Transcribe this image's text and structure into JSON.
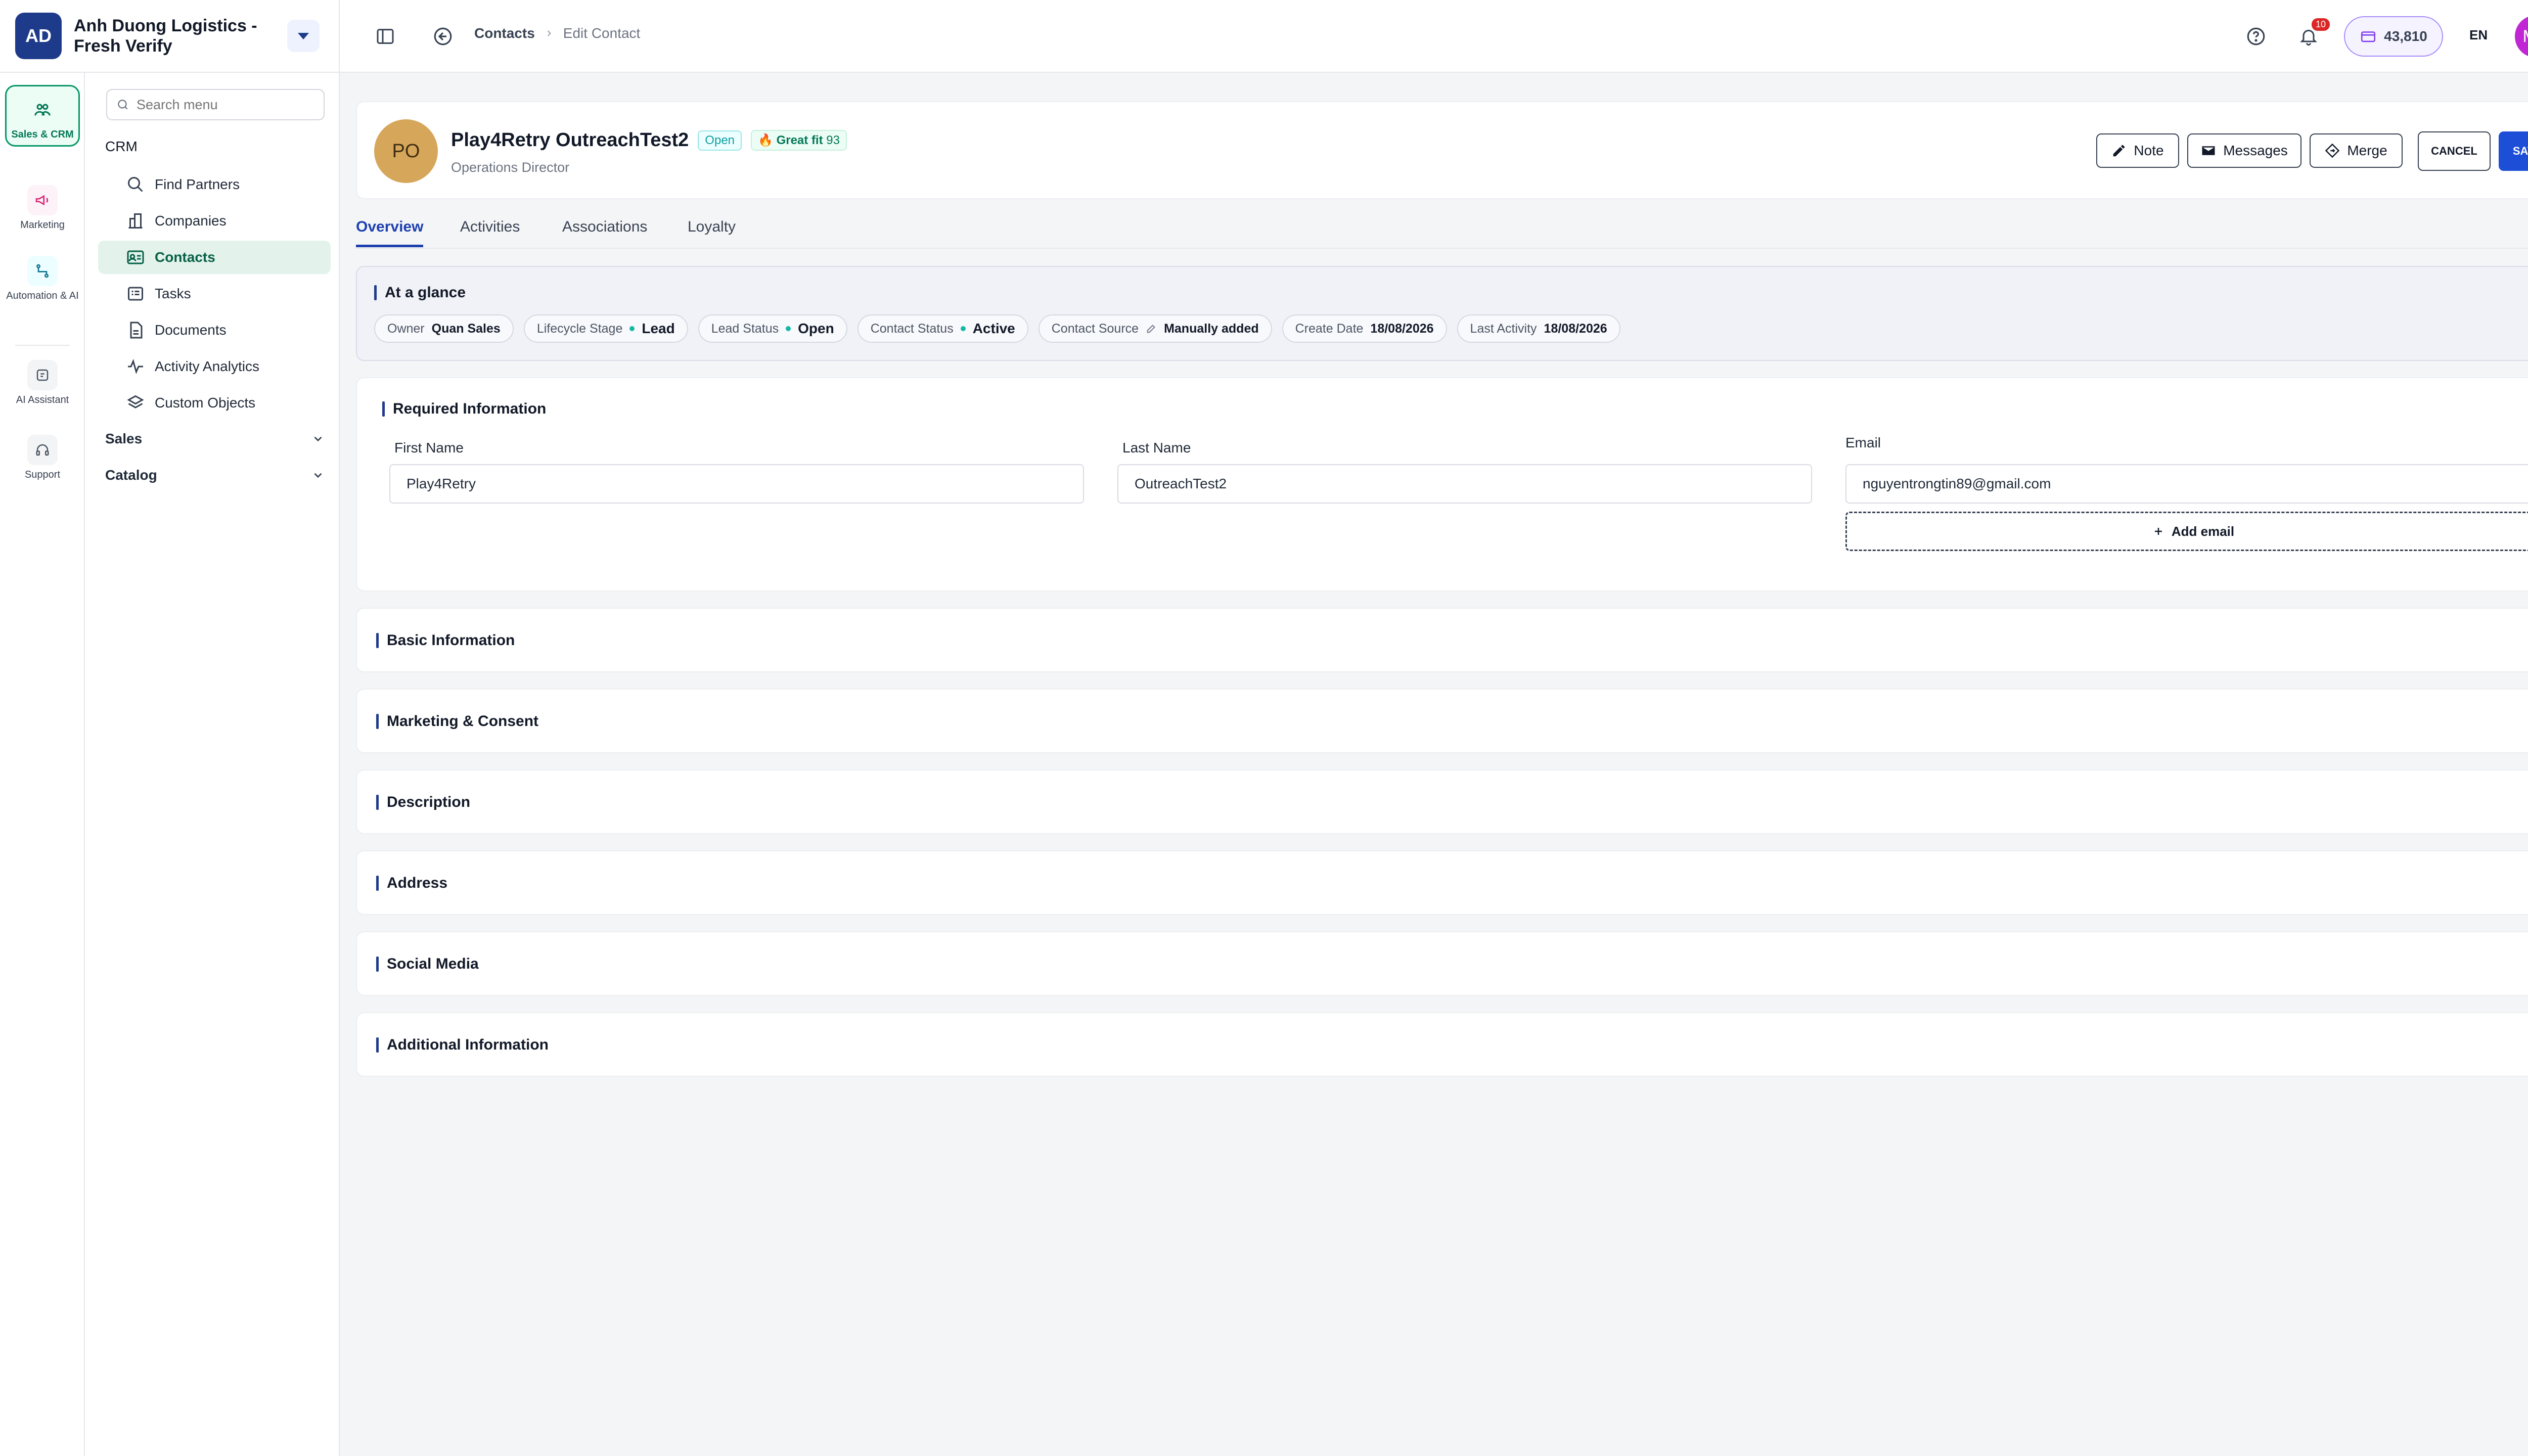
{
  "org": {
    "initials": "AD",
    "name": "Anh Duong Logistics - Fresh Verify"
  },
  "rail": [
    {
      "label": "Sales & CRM",
      "icon": "users-icon"
    },
    {
      "label": "Marketing",
      "icon": "megaphone-icon"
    },
    {
      "label": "Automation & AI",
      "icon": "workflow-icon"
    },
    {
      "label": "AI Assistant",
      "icon": "ai-assistant-icon"
    },
    {
      "label": "Support",
      "icon": "headset-icon"
    }
  ],
  "nav": {
    "search_placeholder": "Search menu",
    "section": "CRM",
    "items": [
      "Find Partners",
      "Companies",
      "Contacts",
      "Tasks",
      "Documents",
      "Activity Analytics",
      "Custom Objects"
    ],
    "groups": [
      "Sales",
      "Catalog"
    ]
  },
  "topbar": {
    "breadcrumb": [
      "Contacts",
      "Edit Contact"
    ],
    "notifications": "10",
    "credits": "43,810",
    "language": "EN",
    "user_initials": "MR"
  },
  "contact": {
    "initials": "PO",
    "name": "Play4Retry OutreachTest2",
    "status_badge": "Open",
    "fit_label": "Great fit",
    "fit_score": "93",
    "role": "Operations Director"
  },
  "actions": {
    "note": "Note",
    "messages": "Messages",
    "merge": "Merge",
    "cancel": "CANCEL",
    "save": "SAVE"
  },
  "tabs": [
    "Overview",
    "Activities",
    "Associations",
    "Loyalty"
  ],
  "glance": {
    "title": "At a glance",
    "owner_label": "Owner",
    "owner": "Quan Sales",
    "lifecycle_label": "Lifecycle Stage",
    "lifecycle": "Lead",
    "lead_status_label": "Lead Status",
    "lead_status": "Open",
    "contact_status_label": "Contact Status",
    "contact_status": "Active",
    "source_label": "Contact Source",
    "source": "Manually added",
    "create_label": "Create Date",
    "create_date": "18/08/2026",
    "last_label": "Last Activity",
    "last_activity": "18/08/2026"
  },
  "required": {
    "title": "Required Information",
    "first_name_label": "First Name",
    "first_name": "Play4Retry",
    "last_name_label": "Last Name",
    "last_name": "OutreachTest2",
    "email_label": "Email",
    "email": "nguyentrongtin89@gmail.com",
    "add_email": "Add email"
  },
  "sections": [
    "Basic Information",
    "Marketing & Consent",
    "Description",
    "Address",
    "Social Media",
    "Additional Information"
  ],
  "colors": {
    "primary": "#1d4ed8",
    "accent_green": "#059669",
    "sidebar_active": "#e3f3ec"
  }
}
